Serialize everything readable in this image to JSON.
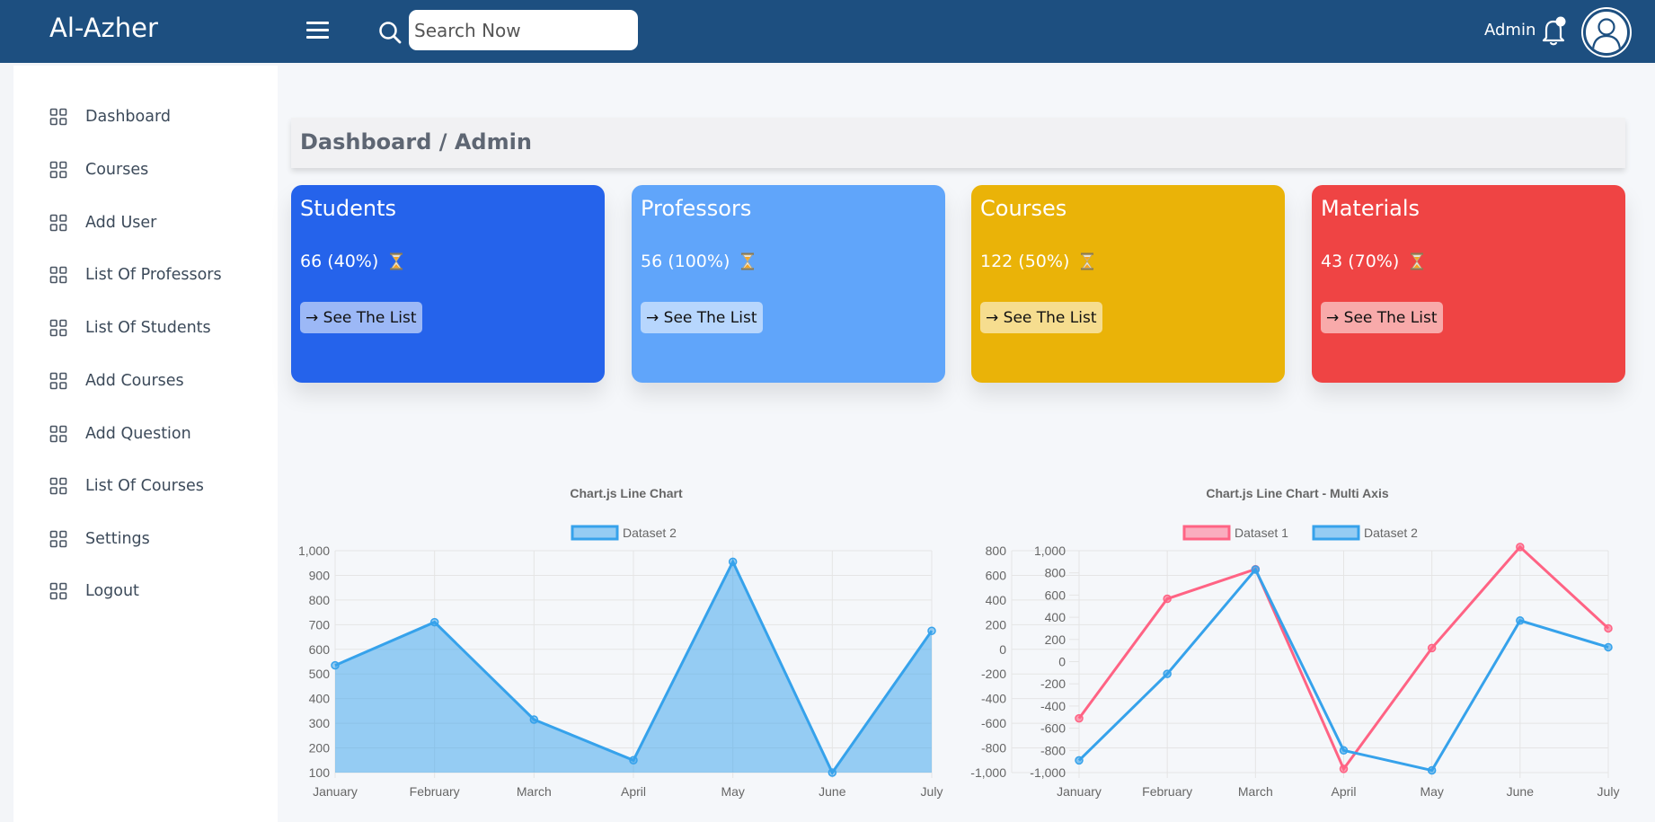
{
  "app": {
    "brand": "Al-Azher"
  },
  "header": {
    "search_placeholder": "Search Now",
    "user_label": "Admin"
  },
  "sidebar": {
    "items": [
      {
        "label": "Dashboard"
      },
      {
        "label": "Courses"
      },
      {
        "label": "Add User"
      },
      {
        "label": "List Of Professors"
      },
      {
        "label": "List Of Students"
      },
      {
        "label": "Add Courses"
      },
      {
        "label": "Add Question"
      },
      {
        "label": "List Of Courses"
      },
      {
        "label": "Settings"
      },
      {
        "label": "Logout"
      }
    ]
  },
  "page": {
    "breadcrumb": "Dashboard / Admin"
  },
  "cards": [
    {
      "title": "Students",
      "value": "66 (40%)",
      "button": "→ See The List",
      "color": "#2563eb"
    },
    {
      "title": "Professors",
      "value": "56 (100%)",
      "button": "→ See The List",
      "color": "#60a5fa"
    },
    {
      "title": "Courses",
      "value": "122 (50%)",
      "button": "→ See The List",
      "color": "#eab308"
    },
    {
      "title": "Materials",
      "value": "43 (70%)",
      "button": "→ See The List",
      "color": "#ef4444"
    }
  ],
  "chart_data": [
    {
      "type": "area",
      "title": "Chart.js Line Chart",
      "categories": [
        "January",
        "February",
        "March",
        "April",
        "May",
        "June",
        "July"
      ],
      "yticks": [
        "1,000",
        "900",
        "800",
        "700",
        "600",
        "500",
        "400",
        "300",
        "200",
        "100"
      ],
      "ylim": [
        100,
        1000
      ],
      "series": [
        {
          "name": "Dataset 2",
          "values": [
            535,
            710,
            315,
            150,
            955,
            100,
            675
          ],
          "color": "#36a2eb"
        }
      ]
    },
    {
      "type": "line",
      "title": "Chart.js Line Chart - Multi Axis",
      "categories": [
        "January",
        "February",
        "March",
        "April",
        "May",
        "June",
        "July"
      ],
      "yticks_left": [
        "800",
        "600",
        "400",
        "200",
        "0",
        "-200",
        "-400",
        "-600",
        "-800",
        "-1,000"
      ],
      "yticks_right": [
        "1,000",
        "800",
        "600",
        "400",
        "200",
        "0",
        "-200",
        "-400",
        "-600",
        "-800",
        "-1,000"
      ],
      "ylim_left": [
        -1000,
        800
      ],
      "ylim_right": [
        -1000,
        1000
      ],
      "series": [
        {
          "name": "Dataset 1",
          "axis": "left",
          "values": [
            -560,
            410,
            650,
            -970,
            10,
            830,
            170
          ],
          "color": "#ff6384"
        },
        {
          "name": "Dataset 2",
          "axis": "right",
          "values": [
            -890,
            -110,
            830,
            -800,
            -980,
            370,
            130
          ],
          "color": "#36a2eb"
        }
      ]
    }
  ]
}
